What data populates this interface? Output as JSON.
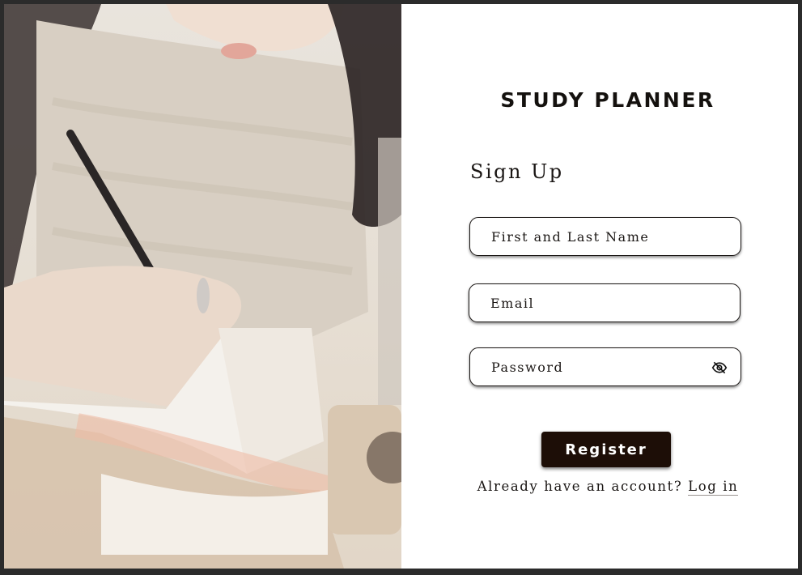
{
  "app": {
    "title": "STUDY PLANNER",
    "photo_alt": "person writing in a notebook"
  },
  "form": {
    "heading": "Sign Up",
    "name_placeholder": "First and Last Name",
    "email_placeholder": "Email",
    "password_placeholder": "Password",
    "password_toggle_icon": "eye-off-icon",
    "register_label": "Register",
    "login_prompt": "Already have an account?",
    "login_link": "Log in"
  },
  "colors": {
    "button_bg": "#1d0e07",
    "text": "#14110e",
    "frame": "#2b2b2b"
  }
}
